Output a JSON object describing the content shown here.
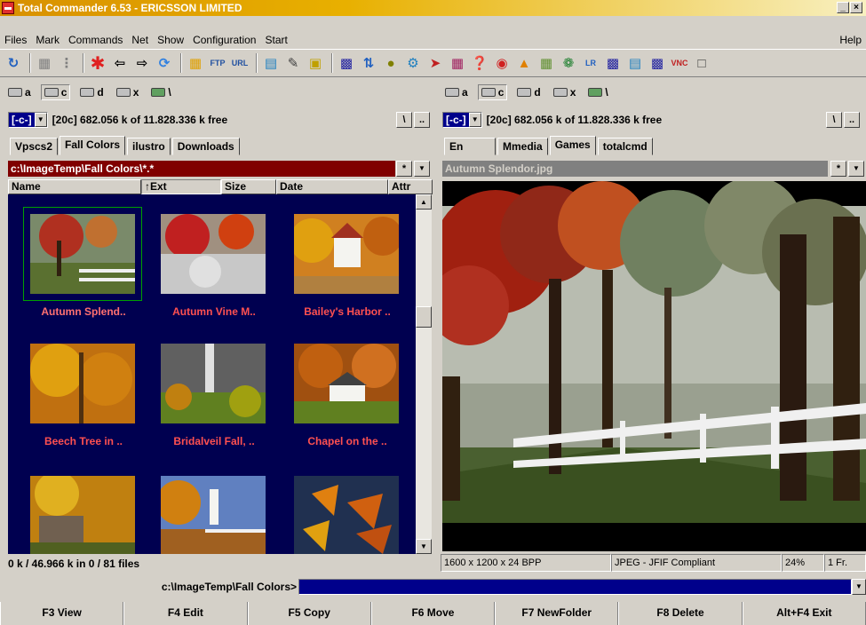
{
  "title": "Total Commander 6.53 - ERICSSON LIMITED",
  "window_buttons": [
    "_",
    "×"
  ],
  "menu": [
    "Files",
    "Mark",
    "Commands",
    "Net",
    "Show",
    "Configuration",
    "Start"
  ],
  "menu_help": "Help",
  "left": {
    "drives": [
      "a",
      "c",
      "d",
      "x",
      "\\"
    ],
    "drive_selected": "[-c-]",
    "free_text": "[20c]  682.056 k of 11.828.336 k free",
    "root_btn": "\\",
    "up_btn": "..",
    "tabs": [
      "Vpscs2",
      "Fall Colors",
      "ilustro",
      "Downloads"
    ],
    "path": "c:\\ImageTemp\\Fall Colors\\*.*",
    "columns": [
      "Name",
      "↑Ext",
      "Size",
      "Date",
      "Attr"
    ],
    "thumbnails": [
      {
        "caption": "Autumn Splend..",
        "selected": true
      },
      {
        "caption": "Autumn Vine M.."
      },
      {
        "caption": "Bailey's Harbor .."
      },
      {
        "caption": "Beech Tree in .."
      },
      {
        "caption": "Bridalveil Fall, .."
      },
      {
        "caption": "Chapel on the .."
      },
      {
        "caption": ""
      },
      {
        "caption": ""
      },
      {
        "caption": ""
      }
    ],
    "status": "0 k / 46.966 k in 0 / 81 files"
  },
  "right": {
    "drives": [
      "a",
      "c",
      "d",
      "x",
      "\\"
    ],
    "drive_selected": "[-c-]",
    "free_text": "[20c]  682.056 k of 11.828.336 k free",
    "root_btn": "\\",
    "up_btn": "..",
    "tabs": [
      "En",
      "Mmedia",
      "Games",
      "totalcmd"
    ],
    "path": "Autumn Splendor.jpg",
    "status": [
      "1600 x 1200 x 24 BPP",
      "JPEG - JFIF Compliant",
      "24%",
      "1 Fr."
    ]
  },
  "panel_star": "*",
  "cmd_path": "c:\\ImageTemp\\Fall Colors>",
  "fkeys": [
    "F3 View",
    "F4 Edit",
    "F5 Copy",
    "F6 Move",
    "F7 NewFolder",
    "F8 Delete",
    "Alt+F4 Exit"
  ]
}
